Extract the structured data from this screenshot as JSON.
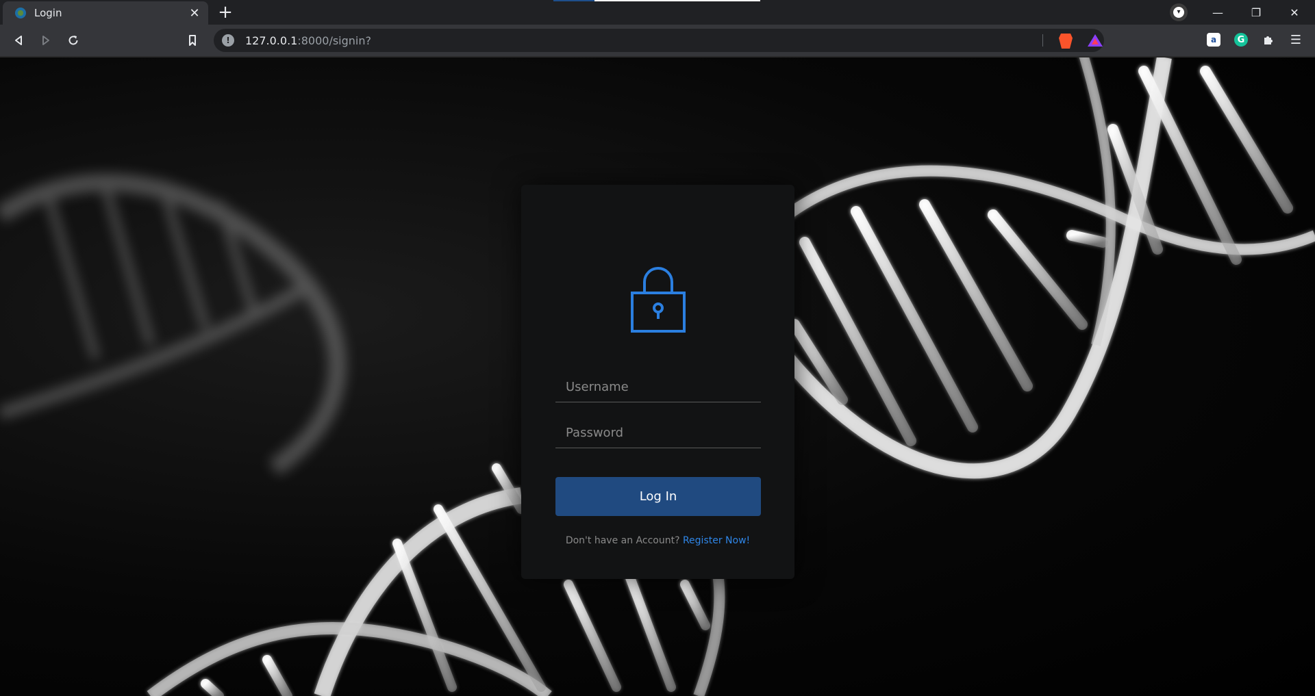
{
  "browser": {
    "tab_title": "Login",
    "tab_close": "✕",
    "new_tab": "+",
    "url_host": "127.0.0.1",
    "url_path": ":8000/signin?",
    "window_buttons": {
      "minimize": "—",
      "restore": "❐",
      "close": "✕"
    },
    "extensions": [
      "amazon-assistant-icon",
      "grammarly-icon",
      "extensions-puzzle-icon"
    ],
    "ext_labels": {
      "amazon": "a",
      "grammarly": "G"
    }
  },
  "login": {
    "username_placeholder": "Username",
    "password_placeholder": "Password",
    "button_label": "Log In",
    "register_prompt": "Don't have an Account? ",
    "register_link": "Register Now!"
  },
  "colors": {
    "accent": "#2f86e8",
    "lock_icon": "#2b7fe0",
    "button": "#204a80",
    "card": "#121314"
  }
}
